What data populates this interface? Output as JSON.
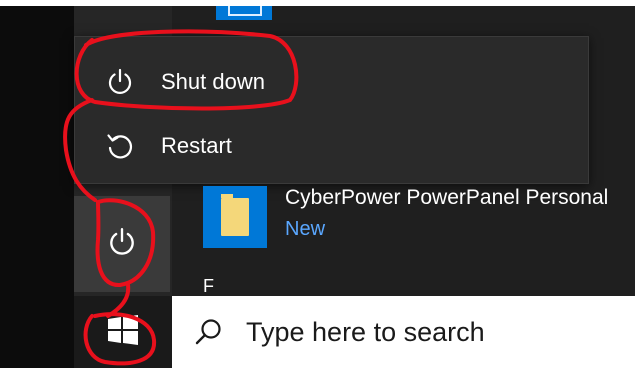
{
  "power_menu": {
    "items": [
      {
        "label": "Shut down",
        "icon": "power-icon"
      },
      {
        "label": "Restart",
        "icon": "restart-icon"
      }
    ]
  },
  "app_list": {
    "entry": {
      "name": "CyberPower PowerPanel Personal",
      "badge": "New",
      "icon": "folder-icon"
    },
    "section_letter": "F"
  },
  "taskbar": {
    "start_icon": "windows-logo-icon",
    "power_icon": "power-icon",
    "search": {
      "placeholder": "Type here to search",
      "icon": "search-icon"
    }
  },
  "colors": {
    "accent": "#0078d7",
    "new_badge": "#5aa7ff",
    "annotation": "#e8101c",
    "menu_bg": "#2a2a2a",
    "rail_bg": "#262626"
  }
}
